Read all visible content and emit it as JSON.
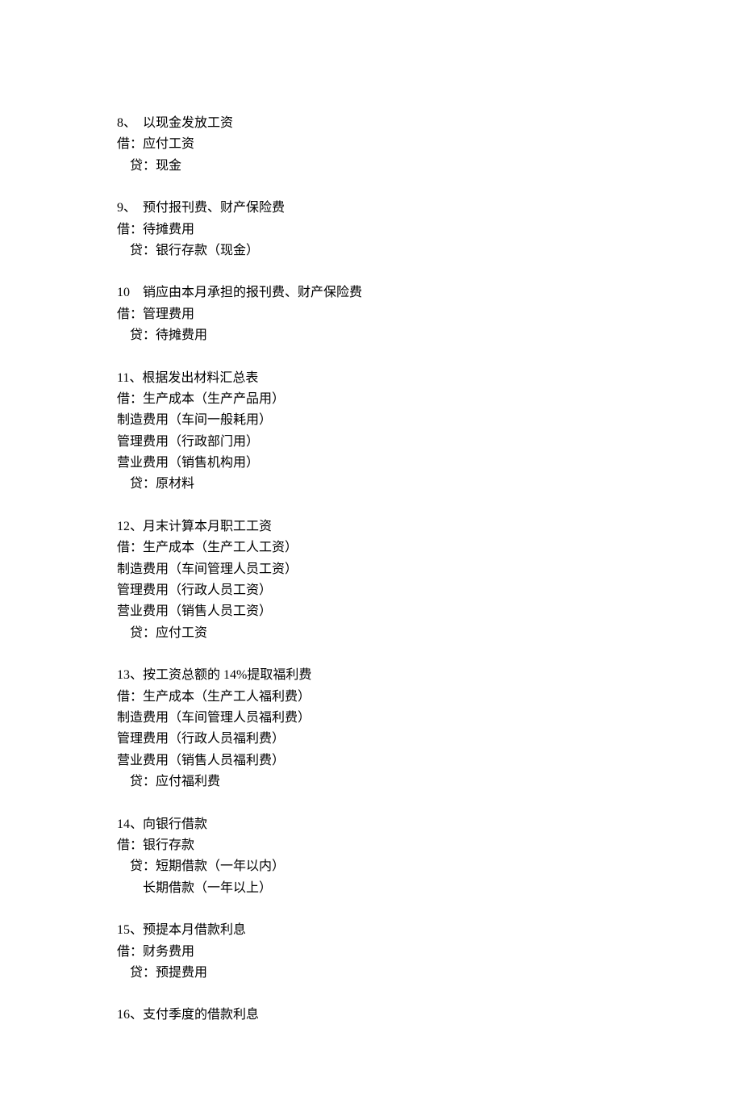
{
  "entries": [
    {
      "lines": [
        {
          "text": "8、  以现金发放工资",
          "indent": 0
        },
        {
          "text": "借：应付工资",
          "indent": 0
        },
        {
          "text": "贷：现金",
          "indent": 1
        }
      ]
    },
    {
      "lines": [
        {
          "text": "9、  预付报刊费、财产保险费",
          "indent": 0
        },
        {
          "text": "借：待摊费用",
          "indent": 0
        },
        {
          "text": "贷：银行存款（现金）",
          "indent": 1
        }
      ]
    },
    {
      "lines": [
        {
          "text": "10    销应由本月承担的报刊费、财产保险费",
          "indent": 0
        },
        {
          "text": "借：管理费用",
          "indent": 0
        },
        {
          "text": "贷：待摊费用",
          "indent": 1
        }
      ]
    },
    {
      "lines": [
        {
          "text": "11、根据发出材料汇总表",
          "indent": 0
        },
        {
          "text": "借：生产成本（生产产品用）",
          "indent": 0
        },
        {
          "text": "制造费用（车间一般耗用）",
          "indent": 0
        },
        {
          "text": "管理费用（行政部门用）",
          "indent": 0
        },
        {
          "text": "营业费用（销售机构用）",
          "indent": 0
        },
        {
          "text": "贷：原材料",
          "indent": 1
        }
      ]
    },
    {
      "lines": [
        {
          "text": "12、月末计算本月职工工资",
          "indent": 0
        },
        {
          "text": "借：生产成本（生产工人工资）",
          "indent": 0
        },
        {
          "text": "制造费用（车间管理人员工资）",
          "indent": 0
        },
        {
          "text": "管理费用（行政人员工资）",
          "indent": 0
        },
        {
          "text": "营业费用（销售人员工资）",
          "indent": 0
        },
        {
          "text": "贷：应付工资",
          "indent": 1
        }
      ]
    },
    {
      "lines": [
        {
          "text": "13、按工资总额的 14%提取福利费",
          "indent": 0
        },
        {
          "text": "借：生产成本（生产工人福利费）",
          "indent": 0
        },
        {
          "text": "制造费用（车间管理人员福利费）",
          "indent": 0
        },
        {
          "text": "管理费用（行政人员福利费）",
          "indent": 0
        },
        {
          "text": "营业费用（销售人员福利费）",
          "indent": 0
        },
        {
          "text": "贷：应付福利费",
          "indent": 1
        }
      ]
    },
    {
      "lines": [
        {
          "text": "14、向银行借款",
          "indent": 0
        },
        {
          "text": "借：银行存款",
          "indent": 0
        },
        {
          "text": "贷：短期借款（一年以内）",
          "indent": 1
        },
        {
          "text": "长期借款（一年以上）",
          "indent": 2
        }
      ]
    },
    {
      "lines": [
        {
          "text": "15、预提本月借款利息",
          "indent": 0
        },
        {
          "text": "借：财务费用",
          "indent": 0
        },
        {
          "text": "贷：预提费用",
          "indent": 1
        }
      ]
    },
    {
      "lines": [
        {
          "text": "16、支付季度的借款利息",
          "indent": 0
        }
      ]
    }
  ]
}
